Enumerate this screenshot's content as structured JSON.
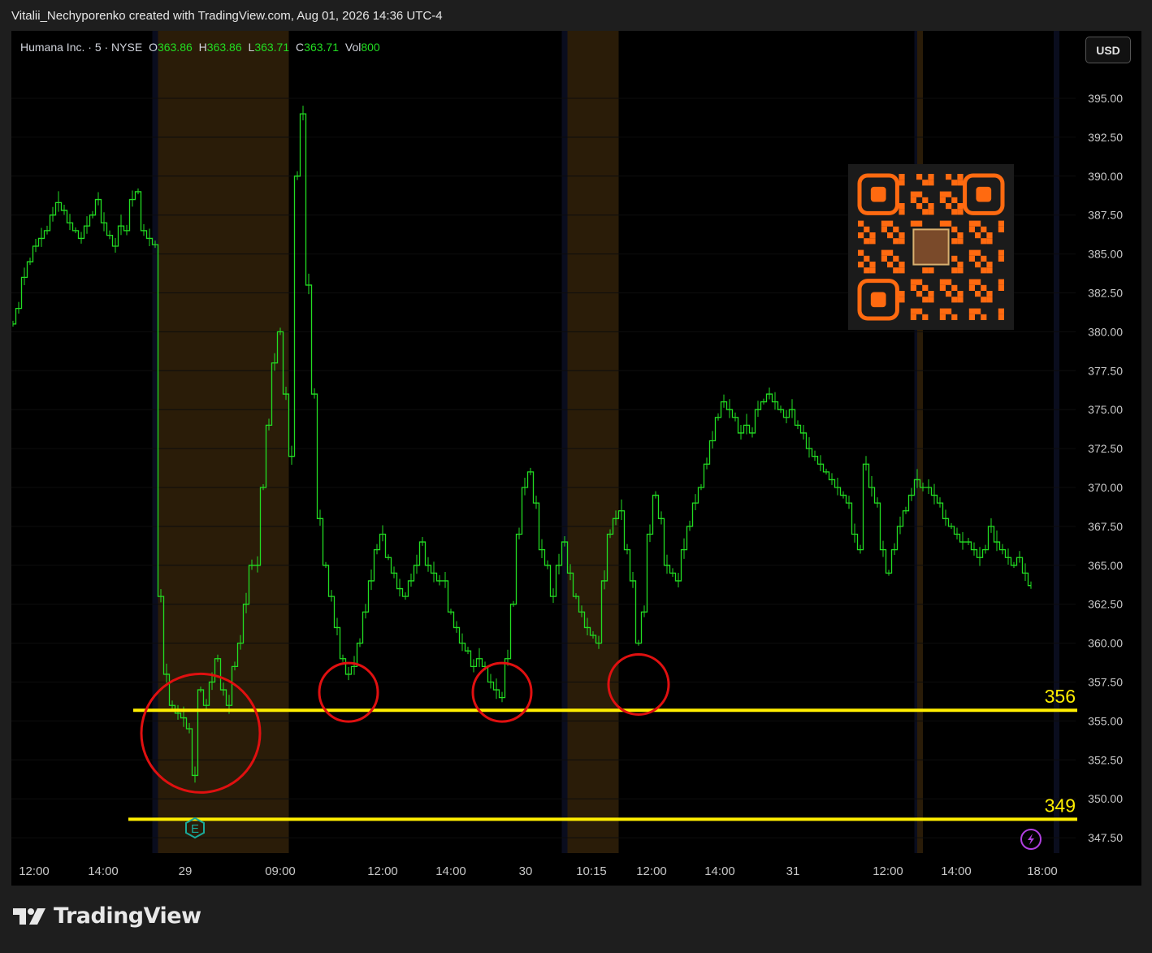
{
  "header": {
    "attribution": "Vitalii_Nechyporenko created with TradingView.com, Aug 01, 2026 14:36 UTC-4"
  },
  "legend": {
    "symbol": "Humana Inc. · 5 · NYSE",
    "o_label": "O",
    "o_value": "363.86",
    "h_label": "H",
    "h_value": "363.86",
    "l_label": "L",
    "l_value": "363.71",
    "c_label": "C",
    "c_value": "363.71",
    "vol_label": "Vol",
    "vol_value": "800"
  },
  "currency": "USD",
  "footer": {
    "brand": "TradingView"
  },
  "colors": {
    "price_line": "#22dd22",
    "level_line": "#ffee00",
    "circle": "#e01010",
    "premarket_band": "#2a1c08",
    "postmarket_band": "#0a0d1e",
    "qr": "#ff6a10",
    "earnings_marker": "#1aa99a",
    "dividend_marker": "#b040e0"
  },
  "icons": {
    "earnings": "earnings-e-icon",
    "split": "lightning-icon",
    "logo": "tradingview-logo-icon",
    "qr": "qr-code-icon"
  },
  "markers": {
    "earnings_letter": "E"
  },
  "chart_data": {
    "type": "line",
    "symbol": "Humana Inc.",
    "interval": "5",
    "exchange": "NYSE",
    "ylim": [
      346.5,
      398.5
    ],
    "y_ticks": [
      "395.00",
      "392.50",
      "390.00",
      "387.50",
      "385.00",
      "382.50",
      "380.00",
      "377.50",
      "375.00",
      "372.50",
      "370.00",
      "367.50",
      "365.00",
      "362.50",
      "360.00",
      "357.50",
      "355.00",
      "352.50",
      "350.00",
      "347.50"
    ],
    "x_ticks": [
      "12:00",
      "14:00",
      "29",
      "09:00",
      "12:00",
      "14:00",
      "30",
      "10:15",
      "12:00",
      "14:00",
      "31",
      "12:00",
      "14:00",
      "18:00"
    ],
    "series": [
      {
        "values": [
          380.5,
          381.5,
          383.5,
          384.5,
          385.5,
          386.0,
          386.5,
          387.5,
          388.3,
          387.8,
          387.0,
          386.5,
          386.0,
          386.8,
          387.5,
          388.5,
          387.0,
          386.2,
          385.5,
          386.8,
          386.5,
          388.5,
          389.0,
          386.5,
          386.0,
          385.6,
          363.0,
          358.0,
          356.0,
          355.5,
          355.2,
          354.5,
          351.5,
          357.0,
          356.0,
          357.5,
          359.0,
          357.0,
          356.0,
          358.5,
          360.0,
          362.5,
          365.0,
          365.0,
          370.0,
          374.0,
          378.0,
          380.0,
          376.0,
          372.0,
          390.0,
          394.0,
          383.0,
          376.0,
          368.0,
          365.0,
          363.0,
          361.0,
          359.0,
          358.0,
          358.5,
          360.0,
          362.0,
          364.0,
          366.0,
          367.0,
          365.5,
          364.5,
          363.5,
          363.0,
          364.0,
          365.0,
          366.5,
          365.0,
          364.5,
          364.0,
          364.0,
          362.0,
          361.0,
          360.0,
          359.5,
          358.5,
          359.0,
          358.5,
          357.5,
          357.0,
          356.5,
          359.0,
          362.5,
          367.0,
          370.0,
          371.0,
          369.0,
          366.0,
          365.0,
          363.0,
          365.0,
          366.5,
          364.5,
          363.0,
          362.0,
          361.0,
          360.5,
          360.0,
          364.0,
          367.0,
          368.0,
          368.5,
          366.0,
          364.0,
          360.0,
          362.0,
          367.0,
          369.5,
          368.0,
          365.0,
          364.5,
          364.0,
          366.0,
          367.5,
          369.0,
          370.0,
          371.5,
          373.0,
          374.5,
          375.5,
          375.0,
          374.5,
          373.5,
          374.0,
          373.5,
          375.0,
          375.5,
          376.0,
          375.5,
          375.0,
          374.5,
          375.0,
          374.0,
          373.5,
          372.5,
          372.0,
          371.5,
          371.0,
          370.5,
          370.0,
          369.5,
          369.0,
          367.0,
          366.0,
          371.5,
          370.0,
          369.0,
          366.0,
          364.5,
          366.0,
          367.5,
          368.5,
          369.5,
          370.5,
          370.0,
          370.0,
          369.5,
          369.0,
          368.0,
          367.5,
          367.0,
          366.5,
          366.5,
          366.0,
          365.5,
          366.0,
          367.5,
          366.5,
          366.0,
          365.5,
          365.0,
          365.5,
          364.5,
          363.7
        ]
      }
    ],
    "levels": [
      {
        "value": 356,
        "label": "356"
      },
      {
        "value": 349,
        "label": "349"
      }
    ],
    "highlight_circles": [
      {
        "x_index": 33,
        "y": 355.0
      },
      {
        "x_index": 59,
        "y": 357.0
      },
      {
        "x_index": 86,
        "y": 357.0
      },
      {
        "x_index": 110,
        "y": 357.5
      }
    ],
    "session_bands": [
      {
        "kind": "post",
        "from_index": 24.5,
        "to_index": 25.5
      },
      {
        "kind": "pre",
        "from_index": 25.5,
        "to_index": 48.5
      },
      {
        "kind": "post",
        "from_index": 96.5,
        "to_index": 97.5
      },
      {
        "kind": "pre",
        "from_index": 97.5,
        "to_index": 106.5
      },
      {
        "kind": "post",
        "from_index": 158.5,
        "to_index": 159.0
      },
      {
        "kind": "pre",
        "from_index": 159.0,
        "to_index": 160.0
      },
      {
        "kind": "post",
        "from_index": 183.0,
        "to_index": 184.0
      }
    ]
  }
}
